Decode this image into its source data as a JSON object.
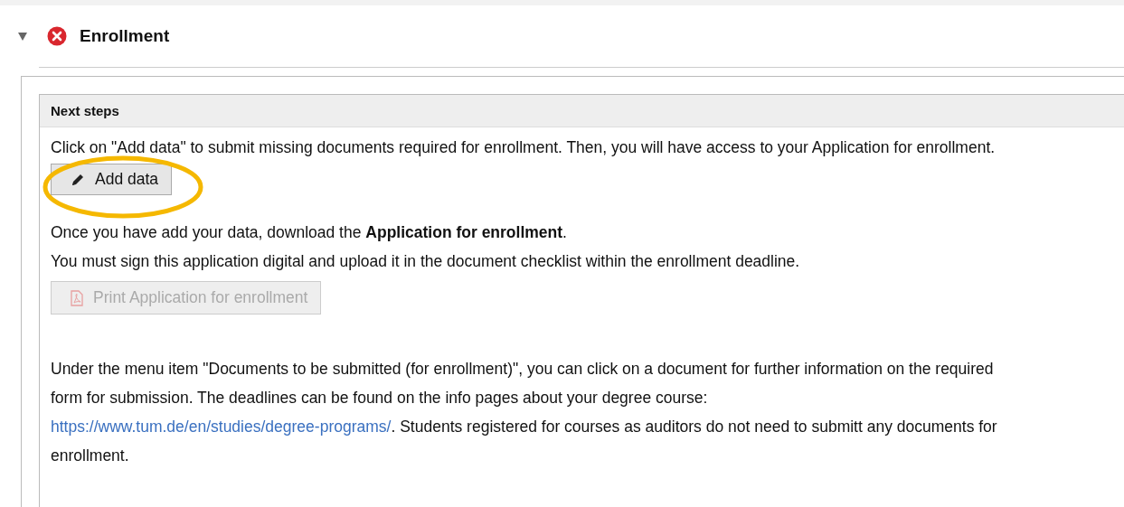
{
  "section": {
    "title": "Enrollment",
    "expanded": true
  },
  "panel": {
    "title": "Next steps",
    "intro": "Click on \"Add data\" to submit missing documents required for enrollment. Then, you will have access to your Application for enrollment.",
    "add_button": {
      "label": "Add data",
      "disabled": false
    },
    "instructions": [
      "Once you have add your data, download the **Application for enrollment**.",
      "You must sign this application digital and upload it in the document checklist within the enrollment deadline."
    ],
    "print_button": {
      "label": "Print Application for enrollment",
      "disabled": true
    },
    "info_lines": [
      "Under the menu item \"Documents to be submitted (for enrollment)\", you can click on a document for further information on the required",
      "form for submission. The deadlines can be found on the info pages about your degree course:"
    ],
    "link": "https://www.tum.de/en/studies/degree-programs/",
    "link_tail": ". Students registered for courses as auditors do not need to submitt any documents for",
    "last_line": "enrollment."
  }
}
